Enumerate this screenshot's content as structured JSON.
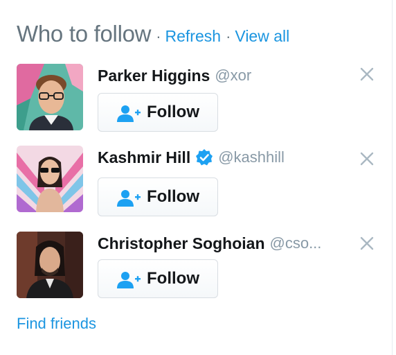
{
  "module": {
    "title": "Who to follow",
    "separator": "·",
    "refresh_label": "Refresh",
    "view_all_label": "View all",
    "find_friends_label": "Find friends"
  },
  "users": [
    {
      "name": "Parker Higgins",
      "handle": "@xor",
      "verified": false,
      "follow_label": "Follow",
      "follow_icon": "add-person-icon",
      "dismiss_icon": "close-icon"
    },
    {
      "name": "Kashmir Hill",
      "handle": "@kashhill",
      "verified": true,
      "follow_label": "Follow",
      "follow_icon": "add-person-icon",
      "dismiss_icon": "close-icon"
    },
    {
      "name": "Christopher Soghoian",
      "handle": "@cso...",
      "verified": false,
      "follow_label": "Follow",
      "follow_icon": "add-person-icon",
      "dismiss_icon": "close-icon"
    }
  ],
  "colors": {
    "link": "#1b95e0",
    "title": "#66757f",
    "handle": "#8899a6",
    "name": "#14171a",
    "icon_blue": "#1da1f2",
    "close_gray": "#aab8c2",
    "button_border": "#d8dde2"
  }
}
